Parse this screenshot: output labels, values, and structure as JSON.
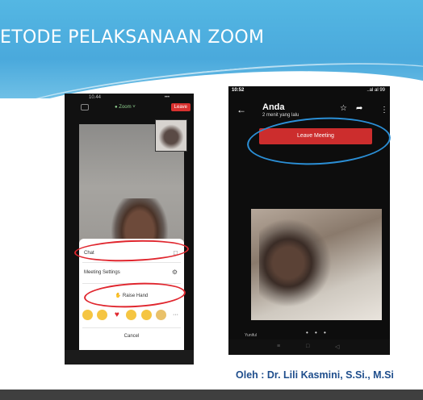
{
  "slide": {
    "title": "ETODE PELAKSANAAN ZOOM",
    "author": "Oleh : Dr. Lili Kasmini, S.Si., M.Si"
  },
  "left_phone": {
    "status_time": "10.44",
    "status_right": "•••",
    "app_label": "Zoom",
    "leave_label": "Leave",
    "menu": {
      "chat_label": "Chat",
      "settings_label": "Meeting Settings",
      "raise_hand_label": "Raise Hand",
      "cancel_label": "Cancel",
      "more_label": "···"
    },
    "reactions": [
      "clap",
      "thumbs-up",
      "heart",
      "joy",
      "open-mouth",
      "tada"
    ]
  },
  "right_phone": {
    "status_time": "10:52",
    "status_right": "..al al 99",
    "contact_name": "Anda",
    "contact_subtitle": "2 menit yang lalu",
    "share_label": "Cari",
    "leave_meeting_label": "Leave Meeting",
    "video_label": "Yuniful",
    "page_dots": "• • •"
  },
  "colors": {
    "header_blue": "#4aa9dc",
    "zoom_red": "#cc2d2d",
    "highlight_red": "#e0262e",
    "highlight_blue": "#2b8fd6",
    "author_blue": "#1f4e8c",
    "footer_gray": "#3f3f3f"
  }
}
